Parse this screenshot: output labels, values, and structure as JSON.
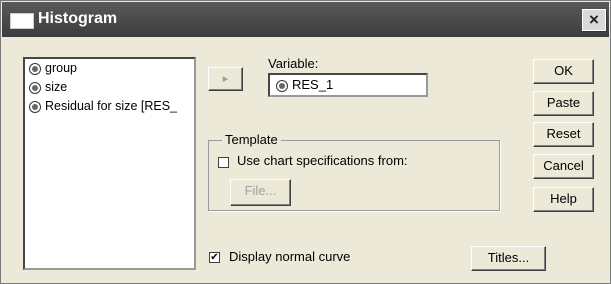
{
  "window": {
    "title": "Histogram",
    "close_glyph": "×"
  },
  "variables_list": [
    {
      "label": "group",
      "icon": "scale-variable-icon"
    },
    {
      "label": "size",
      "icon": "scale-variable-icon"
    },
    {
      "label": "Residual for size [RES_",
      "icon": "scale-variable-icon"
    }
  ],
  "move_button": {
    "glyph": "▸"
  },
  "variable": {
    "label": "Variable:",
    "value": "RES_1"
  },
  "template": {
    "title": "Template",
    "use_chart_spec": {
      "checked": false,
      "label": "Use chart specifications from:"
    },
    "file_button": "File..."
  },
  "buttons": {
    "ok": "OK",
    "paste": "Paste",
    "reset": "Reset",
    "cancel": "Cancel",
    "help": "Help",
    "titles": "Titles..."
  },
  "display_normal_curve": {
    "checked": true,
    "label": "Display normal curve",
    "check_glyph": "✔"
  }
}
